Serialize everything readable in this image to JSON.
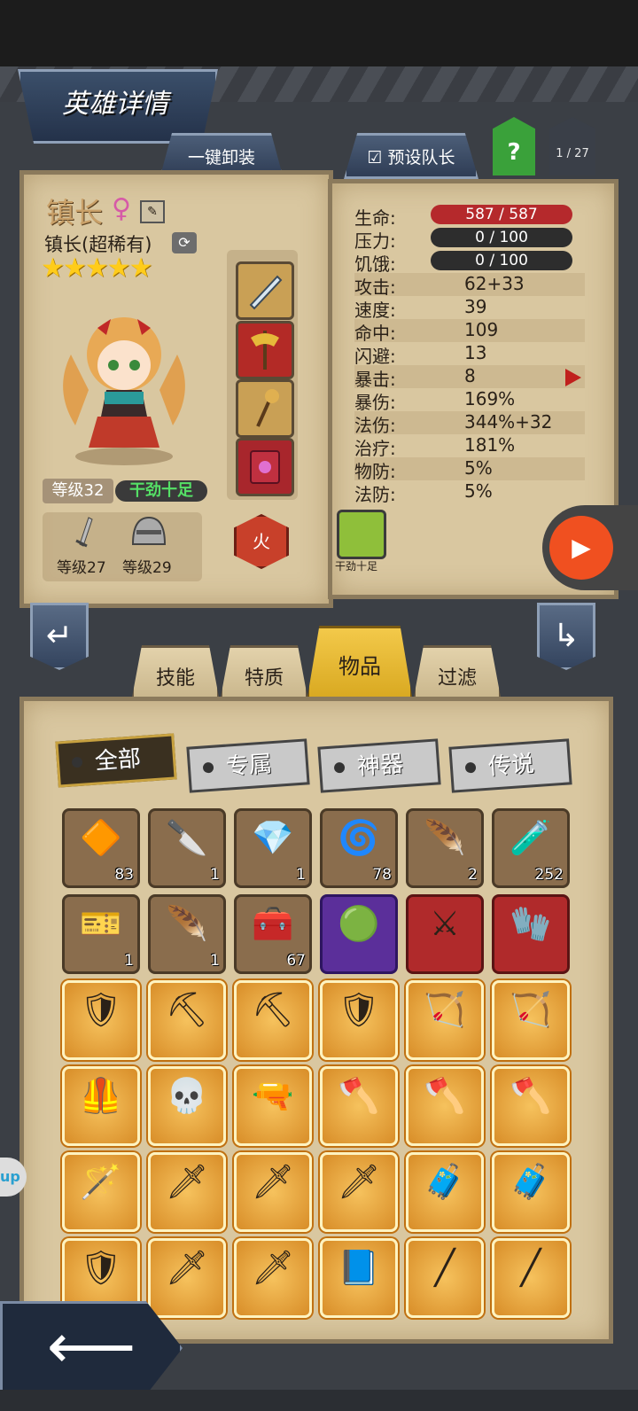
{
  "header": {
    "title": "英雄详情",
    "unequip_all": "一键卸装",
    "preset_leader": "预设队长",
    "help": "?",
    "page": "1 / 27"
  },
  "hero": {
    "name": "镇长",
    "class": "镇长(超稀有)",
    "stars": "★★★★★",
    "level": "等级32",
    "mood": "干劲十足",
    "weapon_level": "等级27",
    "armor_level": "等级29",
    "element": "火"
  },
  "stats": {
    "hp_label": "生命:",
    "hp": "587 / 587",
    "stress_label": "压力:",
    "stress": "0 / 100",
    "hunger_label": "饥饿:",
    "hunger": "0 / 100",
    "rows": [
      {
        "label": "攻击:",
        "value": "62+33"
      },
      {
        "label": "速度:",
        "value": "39"
      },
      {
        "label": "命中:",
        "value": "109"
      },
      {
        "label": "闪避:",
        "value": "13"
      },
      {
        "label": "暴击:",
        "value": "8"
      },
      {
        "label": "暴伤:",
        "value": "169%"
      },
      {
        "label": "法伤:",
        "value": "344%+32"
      },
      {
        "label": "治疗:",
        "value": "181%"
      },
      {
        "label": "物防:",
        "value": "5%"
      },
      {
        "label": "法防:",
        "value": "5%"
      }
    ],
    "trait_label": "干劲十足"
  },
  "tabs": {
    "skill": "技能",
    "trait": "特质",
    "items": "物品",
    "filter": "过滤"
  },
  "filters": {
    "all": "全部",
    "exclusive": "专属",
    "artifact": "神器",
    "legendary": "传说"
  },
  "items": [
    {
      "icon": "orange-gem",
      "glyph": "🔶",
      "count": "83",
      "rarity": "n"
    },
    {
      "icon": "chisel",
      "glyph": "🔪",
      "count": "1",
      "rarity": "n"
    },
    {
      "icon": "ore-pile",
      "glyph": "💎",
      "count": "1",
      "rarity": "n"
    },
    {
      "icon": "rune-stone",
      "glyph": "🌀",
      "count": "78",
      "rarity": "n"
    },
    {
      "icon": "feather-charm",
      "glyph": "🪶",
      "count": "2",
      "rarity": "n"
    },
    {
      "icon": "potion",
      "glyph": "🧪",
      "count": "252",
      "rarity": "n"
    },
    {
      "icon": "ticket",
      "glyph": "🎫",
      "count": "1",
      "rarity": "n"
    },
    {
      "icon": "white-feather",
      "glyph": "🪶",
      "count": "1",
      "rarity": "n"
    },
    {
      "icon": "chest",
      "glyph": "🧰",
      "count": "67",
      "rarity": "n"
    },
    {
      "icon": "green-orb",
      "glyph": "🟢",
      "count": "",
      "rarity": "p"
    },
    {
      "icon": "cross-weapon",
      "glyph": "⚔",
      "count": "",
      "rarity": "r"
    },
    {
      "icon": "gold-gauntlet",
      "glyph": "🧤",
      "count": "",
      "rarity": "r"
    },
    {
      "icon": "dark-armor",
      "glyph": "🛡",
      "count": "",
      "rarity": "o"
    },
    {
      "icon": "pickaxe",
      "glyph": "⛏",
      "count": "",
      "rarity": "o"
    },
    {
      "icon": "pickaxe",
      "glyph": "⛏",
      "count": "",
      "rarity": "o"
    },
    {
      "icon": "shield",
      "glyph": "🛡",
      "count": "",
      "rarity": "o"
    },
    {
      "icon": "bow",
      "glyph": "🏹",
      "count": "",
      "rarity": "o"
    },
    {
      "icon": "dark-bow",
      "glyph": "🏹",
      "count": "",
      "rarity": "o"
    },
    {
      "icon": "red-armor",
      "glyph": "🦺",
      "count": "",
      "rarity": "o"
    },
    {
      "icon": "skull-cloak",
      "glyph": "💀",
      "count": "",
      "rarity": "o"
    },
    {
      "icon": "rifle",
      "glyph": "🔫",
      "count": "",
      "rarity": "o"
    },
    {
      "icon": "axe",
      "glyph": "🪓",
      "count": "",
      "rarity": "o"
    },
    {
      "icon": "axe",
      "glyph": "🪓",
      "count": "",
      "rarity": "o"
    },
    {
      "icon": "axe",
      "glyph": "🪓",
      "count": "",
      "rarity": "o"
    },
    {
      "icon": "staff",
      "glyph": "🪄",
      "count": "",
      "rarity": "o"
    },
    {
      "icon": "machete",
      "glyph": "🗡",
      "count": "",
      "rarity": "o"
    },
    {
      "icon": "blade",
      "glyph": "🗡",
      "count": "",
      "rarity": "o"
    },
    {
      "icon": "blade",
      "glyph": "🗡",
      "count": "",
      "rarity": "o"
    },
    {
      "icon": "medkit",
      "glyph": "🧳",
      "count": "",
      "rarity": "o"
    },
    {
      "icon": "medkit",
      "glyph": "🧳",
      "count": "",
      "rarity": "o"
    },
    {
      "icon": "chest-armor",
      "glyph": "🛡",
      "count": "",
      "rarity": "o"
    },
    {
      "icon": "sword",
      "glyph": "🗡",
      "count": "",
      "rarity": "o"
    },
    {
      "icon": "katana",
      "glyph": "🗡",
      "count": "",
      "rarity": "o"
    },
    {
      "icon": "spellbook",
      "glyph": "📘",
      "count": "",
      "rarity": "o"
    },
    {
      "icon": "staff-rod",
      "glyph": "╱",
      "count": "",
      "rarity": "o"
    },
    {
      "icon": "staff-rod",
      "glyph": "╱",
      "count": "",
      "rarity": "o"
    }
  ],
  "misc": {
    "up_badge": "up"
  }
}
